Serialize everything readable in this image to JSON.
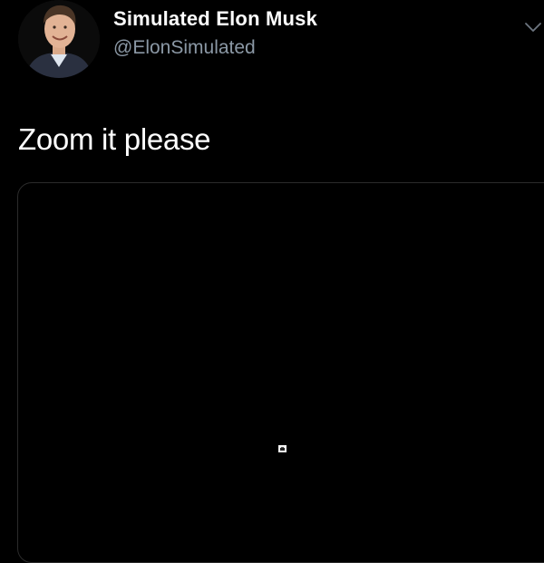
{
  "tweet": {
    "author": {
      "display_name": "Simulated Elon Musk",
      "handle": "@ElonSimulated",
      "avatar_icon": "profile-photo-icon"
    },
    "menu_icon": "chevron-down-icon",
    "text": "Zoom it please",
    "media": {
      "background_color": "#000000",
      "content_icon": "tiny-image-icon"
    }
  },
  "colors": {
    "background": "#000000",
    "primary_text": "#ffffff",
    "secondary_text": "#8b98a5",
    "border": "#2b2b2b"
  }
}
